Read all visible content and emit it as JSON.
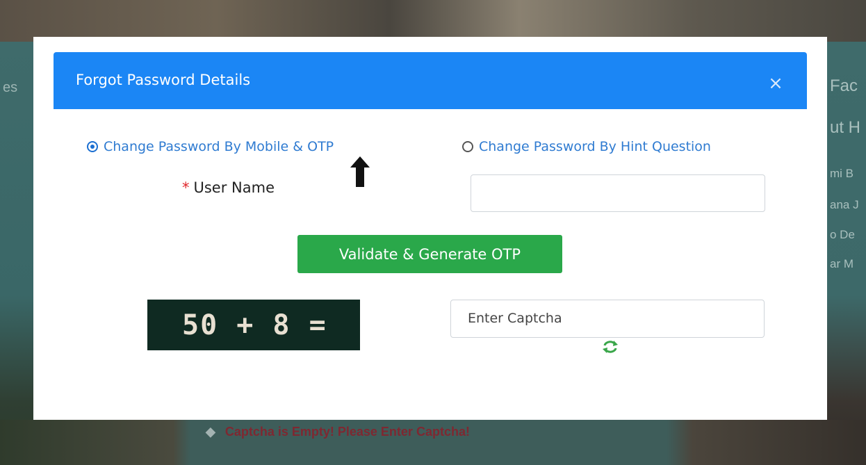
{
  "background": {
    "left_partial_text": "es",
    "right_partial_texts": [
      "Fac",
      "ut H",
      "mi B",
      "ana J",
      "o De",
      "ar M"
    ],
    "warning": "Captcha is Empty! Please Enter Captcha!"
  },
  "modal": {
    "title": "Forgot Password Details",
    "close_symbol": "×",
    "options": [
      {
        "label": "Change Password By Mobile & OTP",
        "selected": true
      },
      {
        "label": "Change Password By Hint Question",
        "selected": false
      }
    ],
    "user_name_required_mark": "*",
    "user_name_label": "User Name",
    "user_name_value": "",
    "otp_button_label": "Validate & Generate OTP",
    "captcha_expression": "50 + 8 =",
    "captcha_placeholder": "Enter Captcha",
    "refresh_icon": "refresh-icon",
    "colors": {
      "header": "#1b86f5",
      "otp_button": "#2aa84a",
      "captcha_bg": "#0f2a22",
      "required": "#e0262b"
    }
  }
}
